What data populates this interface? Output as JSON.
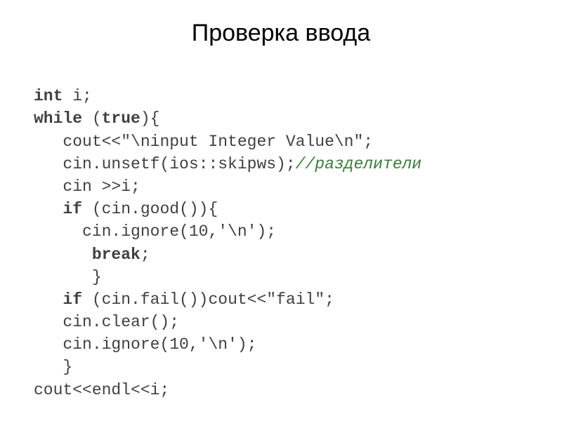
{
  "title": "Проверка ввода",
  "code": {
    "l1_kw1": "int",
    "l1_rest": " i;",
    "l2_kw1": "while",
    "l2_rest1": " (",
    "l2_kw2": "true",
    "l2_rest2": "){",
    "l3_a": "   cout<<",
    "l3_str": "\"\\ninput Integer Value\\n\"",
    "l3_b": ";",
    "l4_a": "   cin.unsetf(ios::skipws);",
    "l4_cmt": "//разделители",
    "l5": "   cin >>i;",
    "l6_a": "   ",
    "l6_kw": "if",
    "l6_b": " (cin.good()){",
    "l7_a": "     cin.ignore(10,",
    "l7_ch": "'\\n'",
    "l7_b": ");",
    "l8_a": "      ",
    "l8_kw": "break",
    "l8_b": ";",
    "l9": "      }",
    "l10_a": "   ",
    "l10_kw": "if",
    "l10_b": " (cin.fail())cout<<",
    "l10_str": "\"fail\"",
    "l10_c": ";",
    "l11": "   cin.clear();",
    "l12_a": "   cin.ignore(10,",
    "l12_ch": "'\\n'",
    "l12_b": ");",
    "l13": "   }",
    "l14": "cout<<endl<<i;"
  }
}
